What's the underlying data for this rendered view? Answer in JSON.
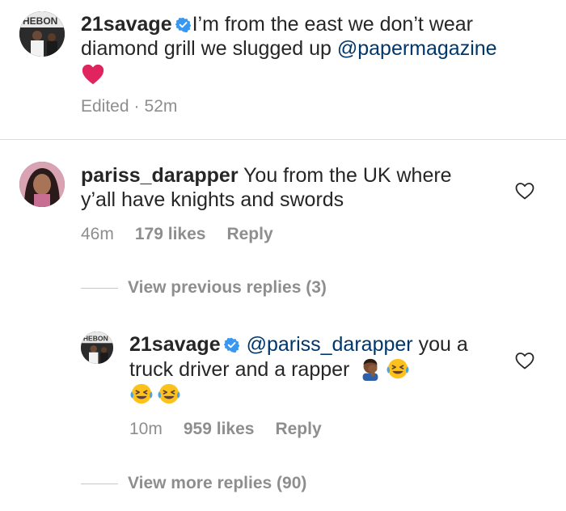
{
  "caption": {
    "username": "21savage",
    "text_before_mention": "I’m from the east we don’t wear diamond grill we slugged up ",
    "mention": "@papermagazine",
    "trailing_emoji": "red-heart",
    "edited": "Edited",
    "separator": "·",
    "time": "52m"
  },
  "comment": {
    "username": "pariss_darapper",
    "text": "You from the UK where y’all have knights and swords",
    "time": "46m",
    "likes": "179 likes",
    "reply_label": "Reply"
  },
  "view_previous": "View previous replies (3)",
  "reply": {
    "username": "21savage",
    "mention": "@pariss_darapper",
    "text": "you a truck driver and a rapper",
    "emojis": [
      "man-facepalming",
      "face-with-tears-of-joy",
      "face-with-tears-of-joy",
      "face-with-tears-of-joy"
    ],
    "time": "10m",
    "likes": "959 likes",
    "reply_label": "Reply"
  },
  "view_more": "View more replies (90)",
  "colors": {
    "text": "#262626",
    "muted": "#8e8e8e",
    "mention": "#00376b",
    "verified": "#3897f0",
    "heart_emoji": "#e0245e",
    "joy_emoji": "#fcc21b"
  }
}
